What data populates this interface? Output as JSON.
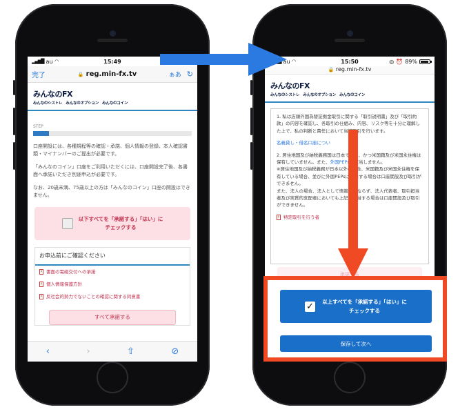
{
  "left": {
    "status": {
      "carrier": "au",
      "time": "15:49"
    },
    "urlbar": {
      "done": "完了",
      "url": "reg.min-fx.tv",
      "aa": "ぁあ"
    },
    "logo": {
      "brand": "みんなのFX",
      "subs": [
        "みんなのシストレ",
        "みんなのオプション",
        "みんなのコイン"
      ]
    },
    "step_label": "STEP",
    "progress_fraction": 0.1,
    "paragraphs": [
      "口座開設には、各種規程等の確認・承諾、個人情報の登録、本人確認書類・マイナンバーのご提出が必要です。",
      "「みんなのコイン」口座をご利用いただくには、口座開設完了後、各書面へ承諾いただき別途申込が必要です。",
      "なお、20歳未満、75歳以上の方は「みんなのコイン」口座の開設はできません。"
    ],
    "check_all": {
      "line1": "以下すべてを「承諾する」「はい」に",
      "line2": "チェックする"
    },
    "confirm": {
      "header": "お申込前にご確認ください",
      "items": [
        "書面の電磁交付への承諾",
        "個人情報保護方針",
        "反社会的勢力でないことの確認に関する同意書"
      ],
      "approve_all": "すべて承諾する"
    }
  },
  "right": {
    "status": {
      "carrier": "au",
      "time": "15:50",
      "battery": "89%"
    },
    "urlbar": {
      "url": "reg.min-fx.tv"
    },
    "logo": {
      "brand": "みんなのFX",
      "subs": [
        "みんなのシストレ",
        "みんなのオプション",
        "みんなのコイン"
      ]
    },
    "terms": {
      "p1": "1. 私は店頭外国為替証拠金取引に関する「取引説明書」及び「取引約款」の内容を確認し、各取引の仕組み、内容、リスク等を十分に理解した上で、私の判断と責任において当該取引を行います。",
      "link1": "名義貸し・借名口座につい",
      "p2a": "2. 居住地国及び納税義務国は日本であり、かつ米国籍及び米国永住権は保有していません。また、",
      "link2": "外国PEPs",
      "p2b": "に該当しません。",
      "p3": "※居住地国及び納税義務が日本以外の場合、米国籍及び米国永住権を保有している場合、並びに外国PEPsに該当する場合は口座開設及び取引ができません。",
      "p4": "また、法人の場合、法人として情報のみならず、法人代表者、取引担当者及び実質的支配者においても上記に該当する場合は口座開設及び取引ができません。",
      "red_link": "特定取引を行う者",
      "ghost_btn": "承諾する"
    },
    "check_all": {
      "line1": "以上すべてを「承諾する」「はい」に",
      "line2": "チェックする"
    },
    "next_button": "保存して次へ"
  },
  "colors": {
    "accent_blue": "#1a6fc9",
    "callout": "#f04a24",
    "arrow_blue": "#2a7ae2",
    "pink": "#fde0e6"
  }
}
